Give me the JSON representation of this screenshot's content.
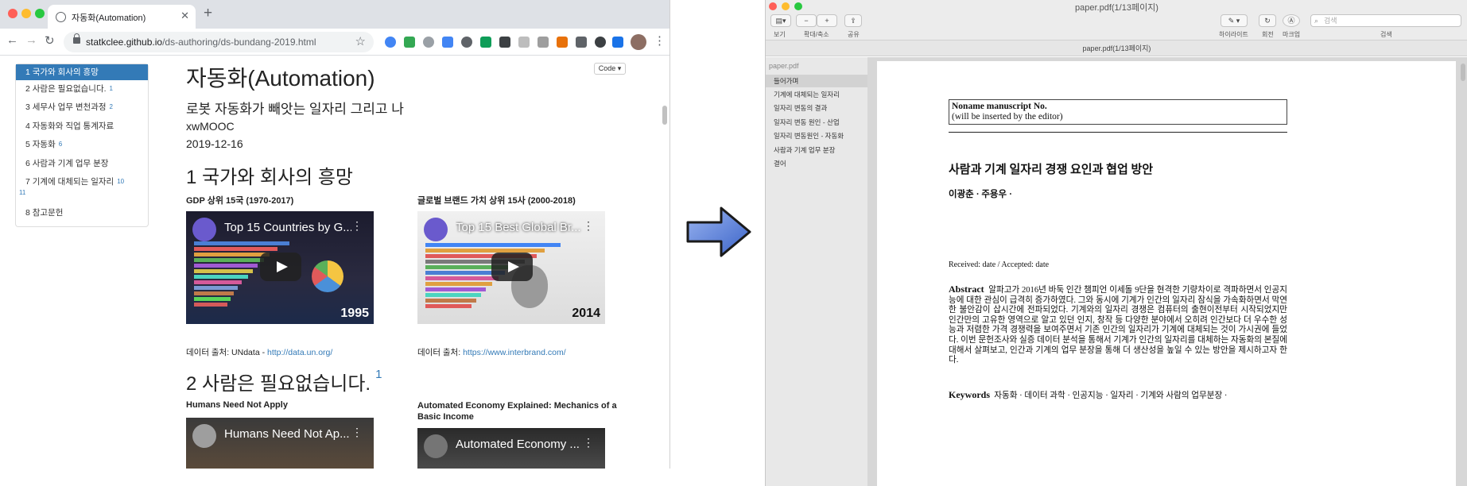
{
  "browser": {
    "tab_title": "자동화(Automation)",
    "url_host": "statkclee.github.io",
    "url_path": "/ds-authoring/ds-bundang-2019.html"
  },
  "toc": [
    {
      "label": "1 국가와 회사의 흥망",
      "sup": ""
    },
    {
      "label": "2 사람은 필요없습니다.",
      "sup": "1"
    },
    {
      "label": "3 세무사 업무 변천과정",
      "sup": "2"
    },
    {
      "label": "4 자동화와 직업 통계자료",
      "sup": ""
    },
    {
      "label": "5 자동화",
      "sup": "6"
    },
    {
      "label": "6 사람과 기계 업무 분장",
      "sup": ""
    },
    {
      "label": "7 기계에 대체되는 일자리",
      "sup": "10",
      "sup2": "11"
    },
    {
      "label": "8 참고문헌",
      "sup": ""
    }
  ],
  "doc": {
    "code_button": "Code ▾",
    "title": "자동화(Automation)",
    "subtitle": "로봇 자동화가 빼앗는 일자리 그리고 나",
    "author": "xwMOOC",
    "date": "2019-12-16",
    "section1": {
      "heading": "1 국가와 회사의 흥망",
      "left_caption": "GDP 상위 15국 (1970-2017)",
      "right_caption": "글로벌 브랜드 가치 상위 15사 (2000-2018)",
      "left_video_title": "Top 15 Countries by G...",
      "right_video_title": "Top 15 Best Global Br...",
      "left_year": "1995",
      "right_year": "2014",
      "left_source_prefix": "데이터 출처: UNdata - ",
      "left_source_link": "http://data.un.org/",
      "right_source_prefix": "데이터 출처: ",
      "right_source_link": "https://www.interbrand.com/"
    },
    "section2": {
      "heading": "2 사람은 필요없습니다.",
      "heading_sup": "1",
      "left_caption": "Humans Need Not Apply",
      "right_caption_line1": "Automated Economy Explained: Mechanics of a",
      "right_caption_line2": "Basic Income",
      "left_video_title": "Humans Need Not Ap...",
      "right_video_title": "Automated Economy ..."
    }
  },
  "preview": {
    "window_title": "paper.pdf(1/13페이지)",
    "subtitle": "paper.pdf(1/13페이지)",
    "labels": {
      "view": "보기",
      "zoom": "확대/축소",
      "share": "공유",
      "highlight": "하이라이트",
      "rotate": "회전",
      "markup": "마크업",
      "search": "검색"
    },
    "search_placeholder": "검색",
    "sidebar_head": "paper.pdf",
    "sidebar_items": [
      "들어가며",
      "기계에 대체되는 일자리",
      "일자리 변동의 결과",
      "일자리 변동 원인 - 산업",
      "일자리 변동원인 - 자동화",
      "사람과 기계 업무 분장",
      "결어"
    ],
    "paper": {
      "ms_line1": "Noname manuscript No.",
      "ms_line2": "(will be inserted by the editor)",
      "title": "사람과 기계 일자리 경쟁 요인과 협업 방안",
      "authors": "이광춘 · 주용우 ·",
      "received": "Received: date / Accepted: date",
      "abstract_label": "Abstract",
      "abstract_text": "알파고가 2016년 바둑 인간 챔피언 이세돌 9단을 현격한 기량차이로 격파하면서 인공지능에 대한 관심이 급격히 증가하였다. 그와 동시에 기계가 인간의 일자리 잠식을 가속화하면서 막연한 불안감이 삽시간에 전파되었다. 기계와의 일자리 경쟁은 컴퓨터의 출현이전부터 시작되었지만 인간만의 고유한 영역으로 알고 있던 인지, 창작 등 다양한 분야에서 오히려 인간보다 더 우수한 성능과 저렴한 가격 경쟁력을 보여주면서 기존 인간의 일자리가 기계에 대체되는 것이 가시권에 들었다. 이번 문헌조사와 실증 데이터 분석을 통해서 기계가 인간의 일자리를 대체하는 자동화의 본질에 대해서 살펴보고, 인간과 기계의 업무 분장을 통해 더 생산성을 높일 수 있는 방안을 제시하고자 한다.",
      "keywords_label": "Keywords",
      "keywords_text": "자동화 · 데이터 과학 · 인공지능 · 일자리 · 기계와 사람의 업무분장 ·"
    }
  }
}
